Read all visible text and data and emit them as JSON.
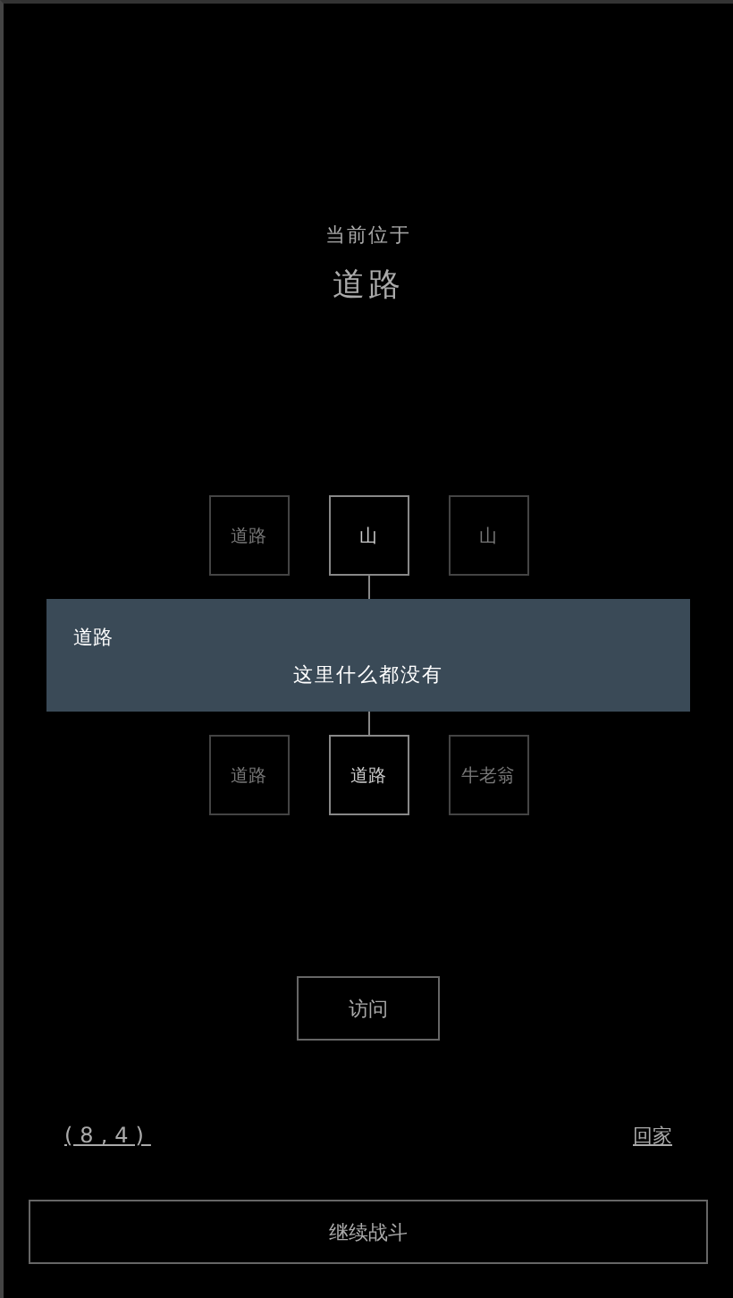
{
  "location": {
    "label": "当前位于",
    "name": "道路"
  },
  "map": {
    "top": [
      {
        "label": "道路",
        "selected": false
      },
      {
        "label": "山",
        "selected": true
      },
      {
        "label": "山",
        "selected": false
      }
    ],
    "bottom": [
      {
        "label": "道路",
        "selected": false
      },
      {
        "label": "道路",
        "selected": true
      },
      {
        "label": "牛老翁",
        "selected": false
      }
    ]
  },
  "banner": {
    "title": "道路",
    "message": "这里什么都没有"
  },
  "visit_button": "访问",
  "coordinates": "(8,4)",
  "home_link": "回家",
  "continue_button": "继续战斗"
}
